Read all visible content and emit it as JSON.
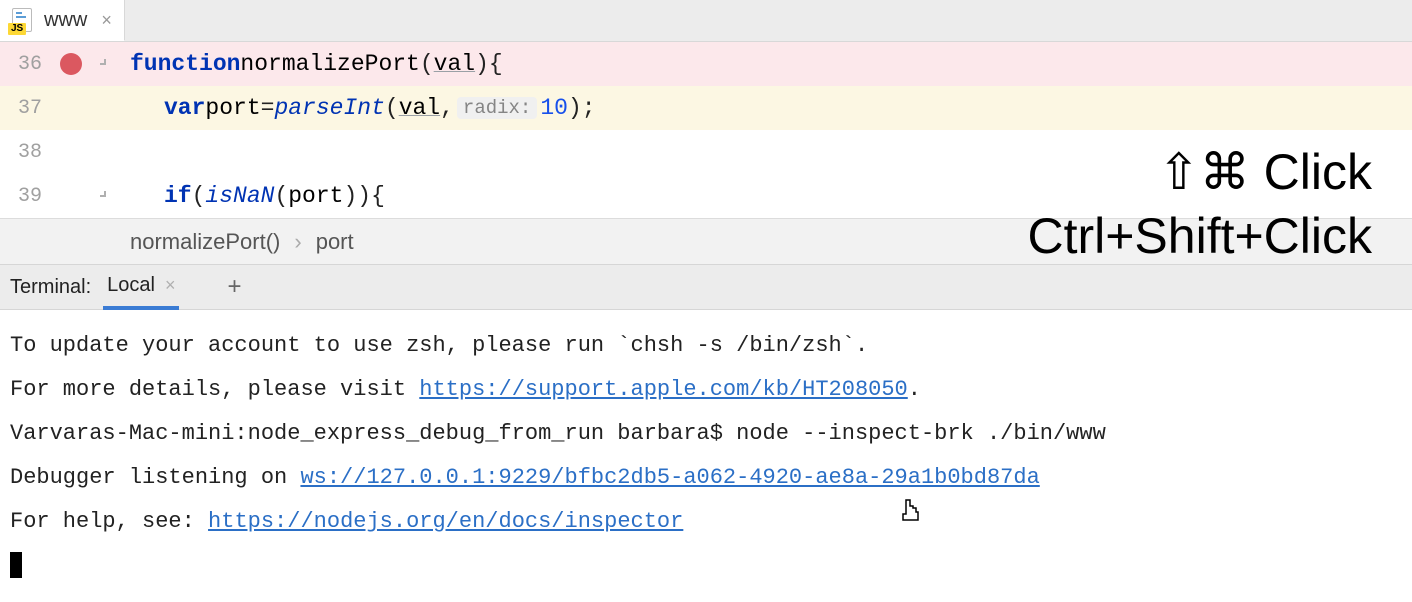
{
  "tab": {
    "file_icon_badge": "JS",
    "file_name": "www"
  },
  "code": {
    "lines": [
      {
        "n": "36",
        "hasBreakpoint": true,
        "hasFold": true,
        "tokens": [
          {
            "t": "kw",
            "v": "function"
          },
          {
            "t": "sp",
            "v": " "
          },
          {
            "t": "fn",
            "v": "normalizePort"
          },
          {
            "t": "pn",
            "v": "("
          },
          {
            "t": "paramU",
            "v": "val"
          },
          {
            "t": "pn",
            "v": ")"
          },
          {
            "t": "sp",
            "v": " "
          },
          {
            "t": "pn",
            "v": "{"
          }
        ]
      },
      {
        "n": "37",
        "hasBreakpoint": false,
        "hasFold": false,
        "tokens": [
          {
            "t": "indent",
            "v": "1"
          },
          {
            "t": "kw",
            "v": "var"
          },
          {
            "t": "sp",
            "v": " "
          },
          {
            "t": "ident",
            "v": "port"
          },
          {
            "t": "sp",
            "v": " "
          },
          {
            "t": "pn",
            "v": "="
          },
          {
            "t": "sp",
            "v": " "
          },
          {
            "t": "callIt",
            "v": "parseInt"
          },
          {
            "t": "pn",
            "v": "("
          },
          {
            "t": "paramU",
            "v": "val"
          },
          {
            "t": "pn",
            "v": ","
          },
          {
            "t": "sp",
            "v": " "
          },
          {
            "t": "hint",
            "v": "radix:"
          },
          {
            "t": "sp",
            "v": " "
          },
          {
            "t": "num",
            "v": "10"
          },
          {
            "t": "pn",
            "v": ");"
          }
        ]
      },
      {
        "n": "38",
        "hasBreakpoint": false,
        "hasFold": false,
        "tokens": []
      },
      {
        "n": "39",
        "hasBreakpoint": false,
        "hasFold": true,
        "tokens": [
          {
            "t": "indent",
            "v": "1"
          },
          {
            "t": "kw",
            "v": "if"
          },
          {
            "t": "sp",
            "v": " "
          },
          {
            "t": "pn",
            "v": "("
          },
          {
            "t": "callIt",
            "v": "isNaN"
          },
          {
            "t": "pn",
            "v": "("
          },
          {
            "t": "ident",
            "v": "port"
          },
          {
            "t": "pn",
            "v": "))"
          },
          {
            "t": "sp",
            "v": " "
          },
          {
            "t": "pn",
            "v": "{"
          }
        ]
      }
    ]
  },
  "breadcrumbs": {
    "item1": "normalizePort()",
    "item2": "port"
  },
  "terminal": {
    "label": "Terminal:",
    "tab": "Local",
    "lines": {
      "l1a": "To update your account to use zsh, please run `chsh -s /bin/zsh`.",
      "l2a": "For more details, please visit ",
      "l2link": "https://support.apple.com/kb/HT208050",
      "l2b": ".",
      "l3": "Varvaras-Mac-mini:node_express_debug_from_run barbara$ node --inspect-brk ./bin/www",
      "l4a": "Debugger listening on ",
      "l4link": "ws://127.0.0.1:9229/bfbc2db5-a062-4920-ae8a-29a1b0bd87da",
      "l5a": "For help, see: ",
      "l5link": "https://nodejs.org/en/docs/inspector"
    }
  },
  "overlay": {
    "line1": "⇧⌘ Click",
    "line2": "Ctrl+Shift+Click"
  }
}
